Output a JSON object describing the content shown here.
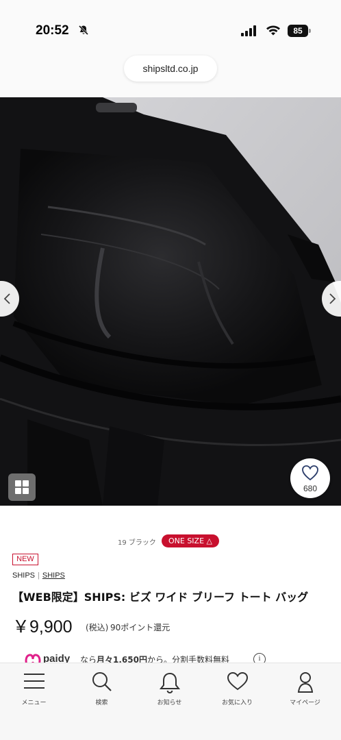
{
  "status_bar": {
    "time": "20:52",
    "battery": "85"
  },
  "browser": {
    "url": "shipsltd.co.jp"
  },
  "product": {
    "favorite_count": "680",
    "color": "19 ブラック",
    "size_label": "ONE SIZE △",
    "new_label": "NEW",
    "brand": "SHIPS",
    "brand_link": "SHIPS",
    "title": "【WEB限定】SHIPS: ビズ ワイド ブリーフ トート バッグ",
    "price": "￥9,900",
    "tax": "(税込)",
    "points": "90ポイント還元"
  },
  "paidy": {
    "logo_text": "paidy",
    "text_prefix": "なら",
    "text_bold": "月々1,650円",
    "text_suffix": "から。分割手数料無料"
  },
  "tabs": [
    {
      "label": "メニュー",
      "icon": "menu-icon"
    },
    {
      "label": "検索",
      "icon": "search-icon"
    },
    {
      "label": "お知らせ",
      "icon": "bell-icon"
    },
    {
      "label": "お気に入り",
      "icon": "heart-icon"
    },
    {
      "label": "マイページ",
      "icon": "person-icon"
    }
  ],
  "colors": {
    "accent": "#c8102e",
    "badge_bg": "#c8102e"
  }
}
